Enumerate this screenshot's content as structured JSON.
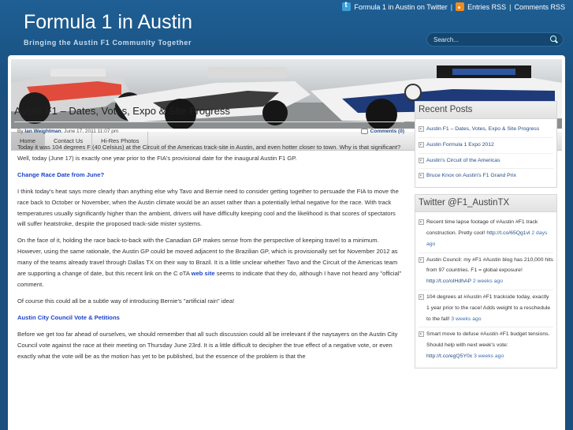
{
  "header": {
    "twitter_link": "Formula 1 in Austin on Twitter",
    "separator": "|",
    "entries_rss": "Entries RSS",
    "comments_rss": "Comments RSS",
    "site_title": "Formula 1 in Austin",
    "tagline": "Bringing the Austin F1 Community Together",
    "search_placeholder": "Search..."
  },
  "nav": {
    "items": [
      "Home",
      "Contact Us",
      "Hi-Res Photos"
    ],
    "active": "Home"
  },
  "post": {
    "title": "Austin F1 – Dates, Votes, Expo & Site Progress",
    "by": "By",
    "author": "Ian Weightman",
    "date": ", June 17, 2011 11:07 pm",
    "comments": "Comments (0)",
    "p1": "Today it was 104 degrees F (40 Celsius) at the Circuit of the Americas track-site in Austin, and even hotter closer to town. Why is that significant? Well, today (June 17) is exactly one year prior to the FIA's provisional date for the inaugural Austin F1 GP.",
    "h1": "Change Race Date from June?",
    "p2": "I think today's heat says more clearly than anything else why Tavo and Bernie need to consider getting together to persuade the FIA to move the race back to October or November, when the Austin climate would be an asset rather than  a potentially lethal negative for the race. With track temperatures usually significantly higher than the ambient, drivers will have difficulty keeping cool and the likelihood is that scores of spectators will suffer heatstroke, despite the proposed track-side mister systems.",
    "p3": "On the face of it, holding the race back-to-back with the Canadian GP makes sense from the perspective of keeping travel to a minimum. However, using the same rationale, the Austin GP could be moved adjacent to the Brazilian GP, which is provisionally set for November 2012 as many of the teams already travel through Dallas TX on their way to Brazil. It is a little unclear whether Tavo and the Circuit of the Americas team are supporting a change of date, but this recent link on the C oTA",
    "p3_link": "web site",
    "p3_end": " seems to indicate that they do, although I have not heard any \"official\" comment.",
    "p4": "Of course this could all be a subtle way of introducing Bernie's \"artificial rain\" idea!",
    "h2": "Austin City Council Vote & Petitions",
    "p5": "Before we get too far ahead of ourselves, we should remember that all such discussion could all be irrelevant if the naysayers on the Austin City Council vote against the race at their meeting on Thursday June 23rd. It is a little difficult to decipher the true effect of a negative vote, or even exactly what the vote will be as the motion has yet to be published, but the essence of the problem is that the"
  },
  "sidebar": {
    "recent_title": "Recent Posts",
    "recent": [
      "Austin F1 – Dates, Votes, Expo & Site Progress",
      "Austin Formula 1 Expo 2012",
      "Austin's Circuit of the Americas",
      "Bruce Knox on Austin's F1 Grand Prix"
    ],
    "twitter_title": "Twitter @F1_AustinTX",
    "tweets": [
      {
        "text": "Recent time lapse footage of #Austin #F1 track construction. Pretty cool! ",
        "link": "http://t.co/65Qg1vl",
        "ago": "2 days ago"
      },
      {
        "text": "Austin Council: my #F1 #Austin blog has 210,000 hits from 97 countries. F1 = global exposure! ",
        "link": "http://t.co/oIHdhAP",
        "ago": "2 weeks ago"
      },
      {
        "text": "104 degrees at #Austin #F1 trackside today, exactly 1 year prior to the race! Adds weight to a reschedule to the fall!",
        "link": "",
        "ago": "3 weeks ago"
      },
      {
        "text": "Smart move to defuse #Austin #F1 budget tensions. Should help with next week's vote: ",
        "link": "http://t.co/egQ5Y0x",
        "ago": "3 weeks ago"
      }
    ]
  },
  "colors": {
    "background": "#1b5688",
    "link": "#244c86",
    "subheading": "#1c43c9"
  }
}
